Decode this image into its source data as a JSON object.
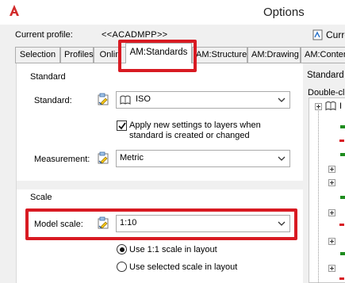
{
  "window": {
    "title": "Options"
  },
  "profile": {
    "label": "Current profile:",
    "value": "<<ACADMPP>>",
    "right_label": "Curre"
  },
  "tabs": [
    {
      "label": "Selection"
    },
    {
      "label": "Profiles"
    },
    {
      "label": "Onlin"
    },
    {
      "label": "AM:Standards"
    },
    {
      "label": "AM:Structure"
    },
    {
      "label": "AM:Drawing"
    },
    {
      "label": "AM:Conten"
    }
  ],
  "standard_group": {
    "title": "Standard",
    "standard_label": "Standard:",
    "standard_value": "ISO",
    "apply_checkbox_line1": "Apply new settings to layers when",
    "apply_checkbox_line2": "standard is created or changed",
    "apply_checked": true,
    "measurement_label": "Measurement:",
    "measurement_value": "Metric"
  },
  "scale_group": {
    "title": "Scale",
    "model_scale_label": "Model scale:",
    "model_scale_value": "1:10",
    "radio_1_label": "Use 1:1 scale in layout",
    "radio_2_label": "Use selected scale in layout",
    "radio_selected": "radio_1"
  },
  "right_panel": {
    "title": "Standard ",
    "hint": "Double-cli",
    "tree_root_label": "I"
  },
  "colors": {
    "highlight_red": "#d81a22",
    "check_green": "#1e8c1e",
    "pencil_yellow": "#f2c316"
  },
  "icons": [
    "autocad-logo",
    "standards-doc-icon",
    "checkmark-icon",
    "chevron-down-icon",
    "tree-expand-icon"
  ]
}
